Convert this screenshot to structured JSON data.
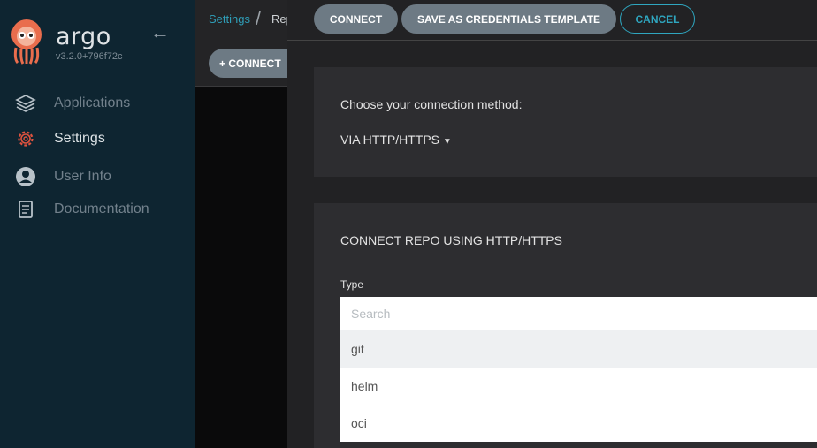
{
  "app": {
    "name": "argo",
    "version": "v3.2.0+796f72c"
  },
  "sidebar": {
    "items": [
      {
        "label": "Applications",
        "icon": "layers-icon"
      },
      {
        "label": "Settings",
        "icon": "gear-icon"
      },
      {
        "label": "User Info",
        "icon": "user-icon"
      },
      {
        "label": "Documentation",
        "icon": "book-icon"
      }
    ]
  },
  "breadcrumb": {
    "root": "Settings",
    "current": "Rep"
  },
  "underlying": {
    "connect_label": "+ CONNECT"
  },
  "panel": {
    "buttons": {
      "connect": "CONNECT",
      "save_template": "SAVE AS CREDENTIALS TEMPLATE",
      "cancel": "CANCEL"
    },
    "method_card": {
      "prompt": "Choose your connection method:",
      "selected": "VIA HTTP/HTTPS"
    },
    "repo_card": {
      "title": "CONNECT REPO USING HTTP/HTTPS",
      "type_label": "Type",
      "search_placeholder": "Search",
      "options": [
        "git",
        "helm",
        "oci"
      ]
    }
  },
  "colors": {
    "accent": "#2fa6bf",
    "active_icon": "#e0533f",
    "sidebar_bg": "#0e2531"
  }
}
